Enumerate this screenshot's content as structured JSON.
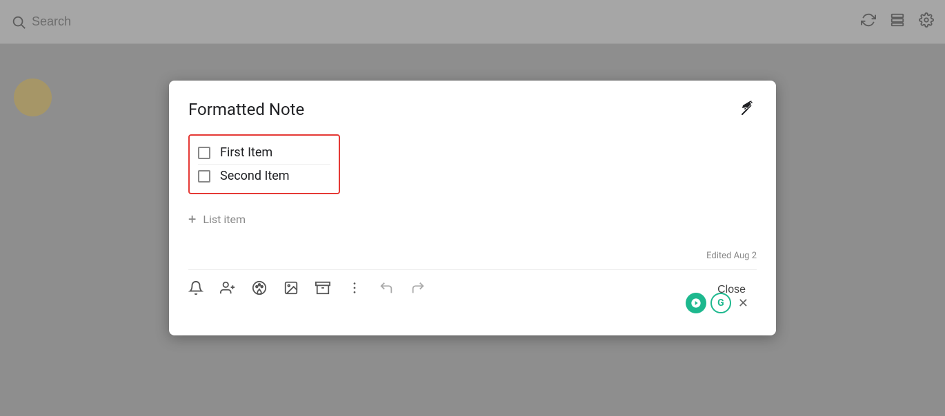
{
  "topbar": {
    "search_placeholder": "Search",
    "refresh_icon": "↻",
    "layout_icon": "☰",
    "settings_icon": "⚙"
  },
  "modal": {
    "title": "Formatted Note",
    "pin_icon": "📌",
    "checklist": {
      "items": [
        {
          "label": "First Item",
          "checked": false
        },
        {
          "label": "Second Item",
          "checked": false
        }
      ]
    },
    "add_item_label": "List item",
    "edited_text": "Edited Aug 2",
    "close_button_label": "Close"
  },
  "toolbar": {
    "bell_label": "🔔",
    "person_add_label": "👤+",
    "palette_label": "🎨",
    "image_label": "🖼",
    "archive_label": "📥",
    "more_label": "⋮",
    "undo_label": "↩",
    "redo_label": "↪"
  }
}
